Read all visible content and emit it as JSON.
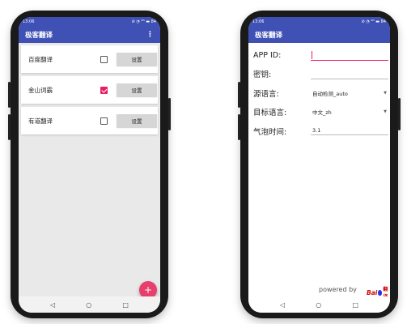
{
  "left_phone": {
    "status": {
      "time": "13:06",
      "right_icons": "⊘ ◔ ⁴ᴳ ▬ 84"
    },
    "appbar": {
      "title": "极客翻译",
      "menu_glyph": "⋮"
    },
    "cards": [
      {
        "label": "百度翻译",
        "checked": false,
        "button": "设置"
      },
      {
        "label": "金山词霸",
        "checked": true,
        "button": "设置"
      },
      {
        "label": "有道翻译",
        "checked": false,
        "button": "设置"
      }
    ],
    "fab_glyph": "+",
    "nav": {
      "back": "◁",
      "home": "○",
      "recent": "□"
    }
  },
  "right_phone": {
    "status": {
      "time": "13:06",
      "right_icons": "⊘ ◔ ⁴ᴳ ▬ 84"
    },
    "appbar": {
      "title": "极客翻译"
    },
    "form": {
      "app_id_label": "APP ID:",
      "app_id_value": "",
      "key_label": "密钥:",
      "key_value": "",
      "source_label": "源语言:",
      "source_value": "自动检测_auto",
      "target_label": "目标语言:",
      "target_value": "中文_zh",
      "bubble_label": "气泡时间:",
      "bubble_value": "3.1"
    },
    "powered_by": "powered by",
    "logo": {
      "bai": "Bai",
      "du": "翻译"
    },
    "nav": {
      "back": "◁",
      "home": "○",
      "recent": "□"
    }
  },
  "colors": {
    "primary": "#3f51b5",
    "accent": "#e91e63",
    "fab": "#e83e6c"
  }
}
